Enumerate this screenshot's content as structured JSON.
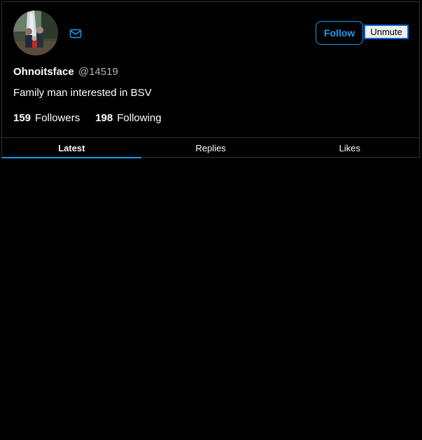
{
  "profile": {
    "avatar_alt": "profile photo",
    "display_name": "Ohnoitsface",
    "handle": "@14519",
    "bio": "Family man interested in BSV",
    "followers_count": "159",
    "followers_label": "Followers",
    "following_count": "198",
    "following_label": "Following"
  },
  "actions": {
    "follow_label": "Follow",
    "unmute_label": "Unmute",
    "message_icon": "envelope-icon"
  },
  "tabs": [
    {
      "label": "Latest",
      "active": true
    },
    {
      "label": "Replies",
      "active": false
    },
    {
      "label": "Likes",
      "active": false
    }
  ],
  "colors": {
    "background": "#000000",
    "accent": "#1d9bf0",
    "border": "#2f3336",
    "text_primary": "#ffffff",
    "text_secondary": "#b5b5b5"
  }
}
